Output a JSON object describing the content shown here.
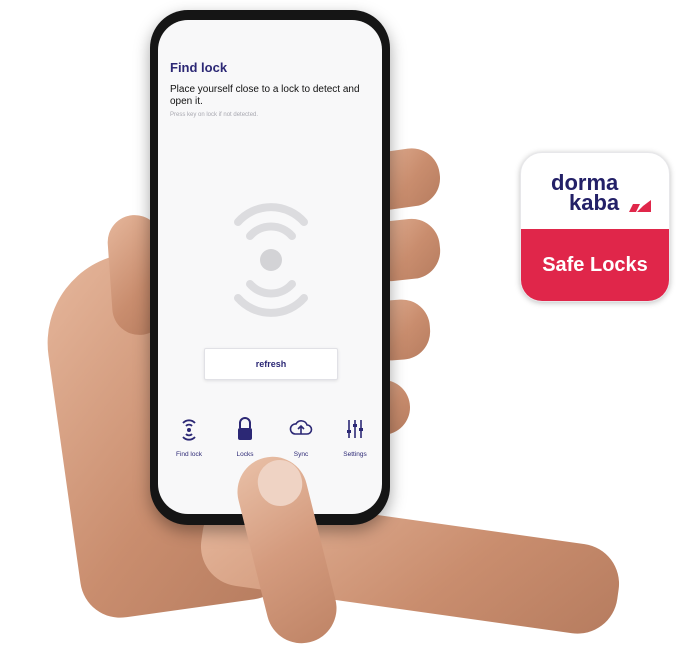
{
  "app": {
    "title": "Find lock",
    "instruction": "Place yourself close to a lock to detect and open it.",
    "hint": "Press key on lock if not detected.",
    "refresh_label": "refresh"
  },
  "tabs": [
    {
      "label": "Find lock",
      "icon": "find-lock-icon"
    },
    {
      "label": "Locks",
      "icon": "lock-icon"
    },
    {
      "label": "Sync",
      "icon": "cloud-sync-icon"
    },
    {
      "label": "Settings",
      "icon": "sliders-icon"
    }
  ],
  "app_icon": {
    "brand_line1": "dorma",
    "brand_line2": "kaba",
    "name": "Safe Locks"
  },
  "colors": {
    "accent": "#2c2875",
    "brand_red": "#e0264a",
    "radar_gray": "#dcdcdf"
  }
}
